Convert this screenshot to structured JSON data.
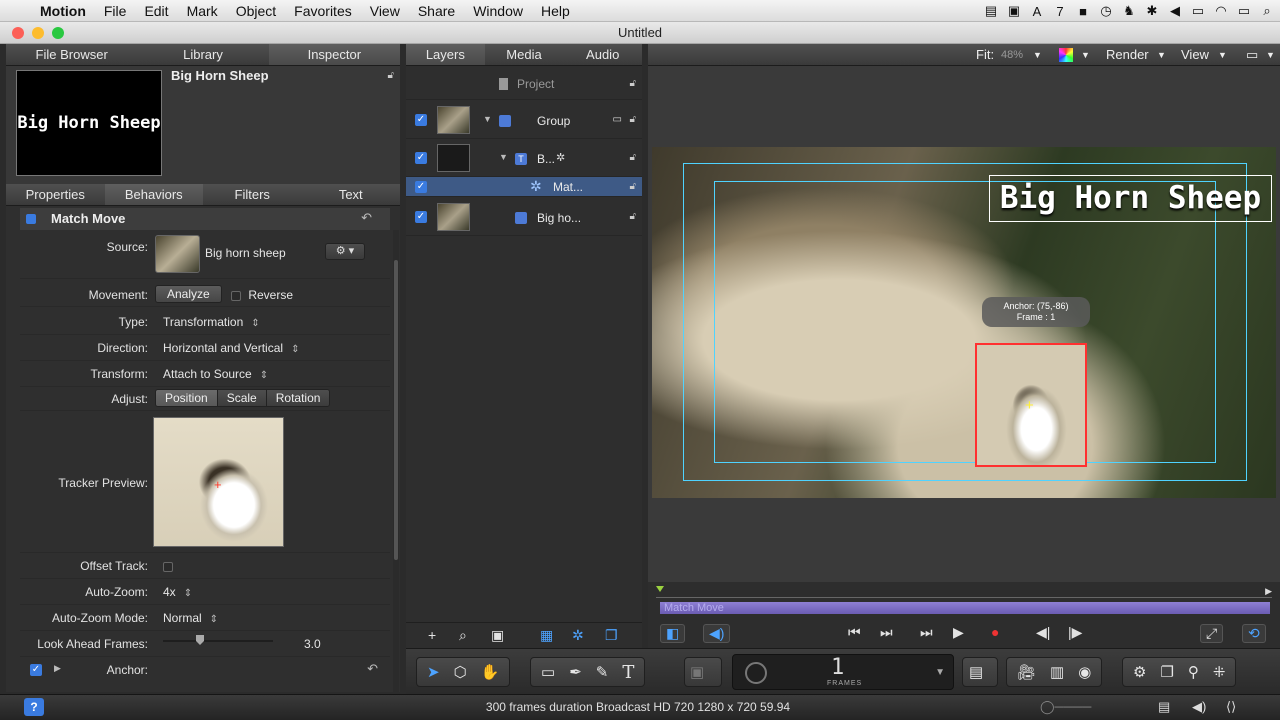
{
  "menubar": {
    "apple": "",
    "items": [
      "Motion",
      "File",
      "Edit",
      "Mark",
      "Object",
      "Favorites",
      "View",
      "Share",
      "Window",
      "Help"
    ],
    "status_count": "7"
  },
  "window": {
    "title": "Untitled"
  },
  "inspector": {
    "tabs": [
      "File Browser",
      "Library",
      "Inspector"
    ],
    "preview_text": "Big Horn Sheep",
    "title": "Big Horn Sheep",
    "subtabs": [
      "Properties",
      "Behaviors",
      "Filters",
      "Text"
    ],
    "behavior_name": "Match Move",
    "source_label": "Source:",
    "source_value": "Big horn sheep",
    "movement_label": "Movement:",
    "analyze_button": "Analyze",
    "reverse_label": "Reverse",
    "type_label": "Type:",
    "type_value": "Transformation",
    "direction_label": "Direction:",
    "direction_value": "Horizontal and Vertical",
    "transform_label": "Transform:",
    "transform_value": "Attach to Source",
    "adjust_label": "Adjust:",
    "adjust_options": [
      "Position",
      "Scale",
      "Rotation"
    ],
    "tracker_preview_label": "Tracker Preview:",
    "offset_track_label": "Offset Track:",
    "auto_zoom_label": "Auto-Zoom:",
    "auto_zoom_value": "4x",
    "auto_zoom_mode_label": "Auto-Zoom Mode:",
    "auto_zoom_mode_value": "Normal",
    "look_ahead_label": "Look Ahead Frames:",
    "look_ahead_value": "3.0",
    "anchor_label": "Anchor:"
  },
  "layers": {
    "tabs": [
      "Layers",
      "Media",
      "Audio"
    ],
    "project": "Project",
    "rows": [
      {
        "name": "Group"
      },
      {
        "name": "B..."
      },
      {
        "name": "Mat..."
      },
      {
        "name": "Big ho..."
      }
    ]
  },
  "canvas": {
    "fit_label": "Fit:",
    "fit_value": "48%",
    "render_label": "Render",
    "view_label": "View",
    "title_text": "Big Horn Sheep",
    "anchor_tip_line1": "Anchor: (75,-86)",
    "anchor_tip_line2": "Frame : 1"
  },
  "timeline": {
    "clip_name": "Match Move"
  },
  "toolbar": {
    "timecode": "1",
    "timecode_unit": "FRAMES"
  },
  "statusbar": {
    "info": "300 frames duration Broadcast HD 720 1280 x 720 59.94",
    "help": "?"
  },
  "colors": {
    "accent": "#3a7be0",
    "tracker": "#ff3030",
    "bounds": "#4fd3ff",
    "clip": "#7d6ec6"
  }
}
